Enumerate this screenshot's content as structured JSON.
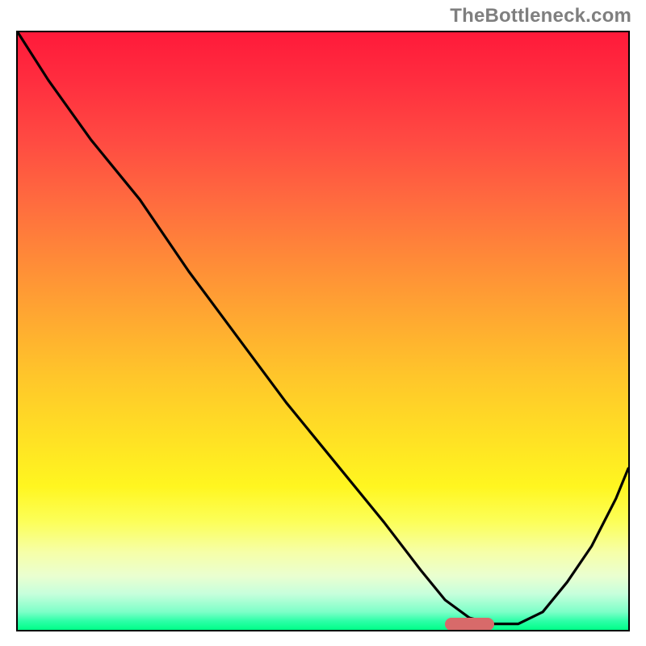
{
  "watermark": "TheBottleneck.com",
  "colors": {
    "frame_border": "#000000",
    "curve": "#000000",
    "marker": "#d86a6a",
    "watermark_text": "#7f7f7f"
  },
  "chart_data": {
    "type": "line",
    "title": "",
    "xlabel": "",
    "ylabel": "",
    "xlim": [
      0,
      100
    ],
    "ylim": [
      0,
      100
    ],
    "grid": false,
    "legend": false,
    "series": [
      {
        "name": "bottleneck-curve",
        "x": [
          0,
          5,
          12,
          20,
          28,
          36,
          44,
          52,
          60,
          66,
          70,
          74,
          78,
          82,
          86,
          90,
          94,
          98,
          100
        ],
        "y": [
          100,
          92,
          82,
          72,
          60,
          49,
          38,
          28,
          18,
          10,
          5,
          2,
          1,
          1,
          3,
          8,
          14,
          22,
          27
        ]
      }
    ],
    "marker": {
      "name": "optimal-range",
      "x_start": 70,
      "x_end": 78,
      "y": 1
    },
    "gradient_stops": [
      {
        "pos": 0.0,
        "color": "#ff1a3a"
      },
      {
        "pos": 0.5,
        "color": "#ffc72a"
      },
      {
        "pos": 0.8,
        "color": "#fcff5a"
      },
      {
        "pos": 0.95,
        "color": "#7dffc8"
      },
      {
        "pos": 1.0,
        "color": "#00ff88"
      }
    ]
  }
}
